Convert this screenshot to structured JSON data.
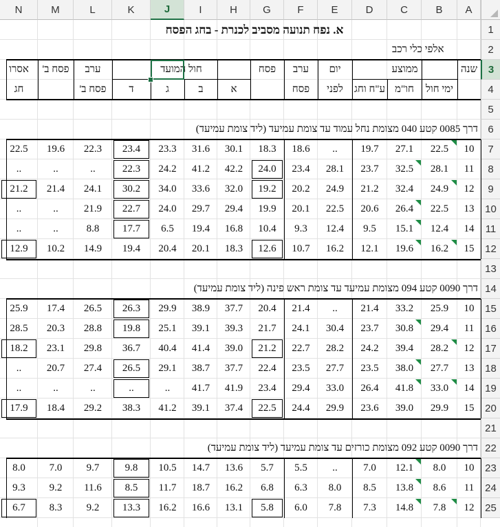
{
  "columns": [
    "N",
    "M",
    "L",
    "K",
    "J",
    "I",
    "H",
    "G",
    "F",
    "E",
    "D",
    "C",
    "B",
    "A"
  ],
  "selected_column": "J",
  "selected_row": "3",
  "rows": [
    "1",
    "2",
    "3",
    "4",
    "5",
    "6",
    "7",
    "8",
    "9",
    "10",
    "11",
    "12",
    "13",
    "14",
    "15",
    "16",
    "17",
    "18",
    "19",
    "20",
    "21",
    "22",
    "23",
    "24",
    "25"
  ],
  "title": "א.  נפח תנועה מסביב לכנרת - בחג הפסח",
  "units": "אלפי כלי רכב",
  "header": {
    "year": "שנה",
    "avg": "ממוצע",
    "weekdays": "ימי חול",
    "hol_hamoed_hdr": "חו\"מ",
    "holiday_rh": "ע\"ח וחג",
    "day_before_1": "יום",
    "day_before_2": "לפני",
    "erev_1": "ערב",
    "erev_2": "פסח",
    "pesach": "פסח",
    "hol_hamoed": "חול המועד",
    "a": "א",
    "b": "ב",
    "g": "ג",
    "d": "ד",
    "erev_b_1": "ערב",
    "erev_b_2": "פסח ב'",
    "pesach_b": "פסח ב'",
    "isru_1": "אסרו",
    "isru_2": "חג"
  },
  "sections": [
    {
      "label": "דרך 0085 קטע 040  מצומת נחל עמוד עד צומת עמיעד  (ליד צומת עמיעד)",
      "rows": [
        {
          "A": "10",
          "B": "22.5",
          "C": "27.1",
          "D": "19.7",
          "E": "..",
          "F": "18.6",
          "G": "18.3",
          "H": "30.1",
          "I": "31.6",
          "J": "23.3",
          "K": "23.4",
          "L": "22.3",
          "M": "19.6",
          "N": "22.5"
        },
        {
          "A": "11",
          "B": "28.1",
          "C": "32.5",
          "D": "23.7",
          "E": "28.1",
          "F": "23.4",
          "G": "24.0",
          "H": "42.2",
          "I": "41.2",
          "J": "24.2",
          "K": "22.3",
          "L": "..",
          "M": "..",
          "N": ".."
        },
        {
          "A": "12",
          "B": "24.9",
          "C": "32.4",
          "D": "21.2",
          "E": "24.9",
          "F": "20.2",
          "G": "19.2",
          "H": "32.0",
          "I": "33.6",
          "J": "34.0",
          "K": "30.2",
          "L": "24.1",
          "M": "21.4",
          "N": "21.2"
        },
        {
          "A": "13",
          "B": "22.5",
          "C": "26.4",
          "D": "20.6",
          "E": "22.5",
          "F": "20.1",
          "G": "19.9",
          "H": "29.4",
          "I": "29.7",
          "J": "24.0",
          "K": "22.7",
          "L": "21.9",
          "M": "..",
          "N": ".."
        },
        {
          "A": "14",
          "B": "12.4",
          "C": "15.1",
          "D": "9.5",
          "E": "12.4",
          "F": "9.3",
          "G": "10.4",
          "H": "16.8",
          "I": "19.4",
          "J": "6.5",
          "K": "17.7",
          "L": "8.8",
          "M": "..",
          "N": ".."
        },
        {
          "A": "15",
          "B": "16.2",
          "C": "19.6",
          "D": "12.1",
          "E": "16.2",
          "F": "10.7",
          "G": "12.6",
          "H": "18.3",
          "I": "20.1",
          "J": "20.4",
          "K": "19.4",
          "L": "14.9",
          "M": "10.2",
          "N": "12.9"
        }
      ]
    },
    {
      "label": "דרך 0090 קטע 094 מצומת עמיעד עד צומת ראש פינה  (ליד צומת עמיעד)",
      "rows": [
        {
          "A": "10",
          "B": "25.9",
          "C": "33.2",
          "D": "21.4",
          "E": "..",
          "F": "21.4",
          "G": "20.4",
          "H": "37.7",
          "I": "38.9",
          "J": "29.9",
          "K": "26.3",
          "L": "26.5",
          "M": "17.4",
          "N": "25.9"
        },
        {
          "A": "11",
          "B": "29.4",
          "C": "30.8",
          "D": "23.7",
          "E": "30.4",
          "F": "24.1",
          "G": "21.7",
          "H": "39.3",
          "I": "39.1",
          "J": "25.1",
          "K": "19.8",
          "L": "28.8",
          "M": "20.3",
          "N": "28.5"
        },
        {
          "A": "12",
          "B": "28.2",
          "C": "39.4",
          "D": "24.2",
          "E": "28.2",
          "F": "22.7",
          "G": "21.2",
          "H": "39.0",
          "I": "41.4",
          "J": "40.4",
          "K": "36.7",
          "L": "29.8",
          "M": "23.1",
          "N": "18.2"
        },
        {
          "A": "13",
          "B": "27.7",
          "C": "38.0",
          "D": "23.5",
          "E": "27.7",
          "F": "23.5",
          "G": "22.4",
          "H": "37.7",
          "I": "38.7",
          "J": "29.1",
          "K": "26.5",
          "L": "27.4",
          "M": "20.7",
          "N": ".."
        },
        {
          "A": "14",
          "B": "33.0",
          "C": "41.8",
          "D": "26.4",
          "E": "33.0",
          "F": "29.4",
          "G": "23.4",
          "H": "41.9",
          "I": "41.7",
          "J": "..",
          "K": "..",
          "L": "..",
          "M": "..",
          "N": ".."
        },
        {
          "A": "15",
          "B": "29.9",
          "C": "39.0",
          "D": "23.6",
          "E": "29.9",
          "F": "24.4",
          "G": "22.5",
          "H": "37.4",
          "I": "39.1",
          "J": "41.2",
          "K": "38.3",
          "L": "29.2",
          "M": "18.4",
          "N": "17.9"
        }
      ]
    },
    {
      "label": "דרך 0090 קטע 092 מצומת כורזים עד צומת עמיעד  (ליד צומת עמיעד)",
      "rows": [
        {
          "A": "10",
          "B": "8.0",
          "C": "12.1",
          "D": "7.0",
          "E": "..",
          "F": "5.5",
          "G": "5.7",
          "H": "13.6",
          "I": "14.7",
          "J": "10.5",
          "K": "9.8",
          "L": "9.7",
          "M": "7.0",
          "N": "8.0"
        },
        {
          "A": "11",
          "B": "8.6",
          "C": "13.8",
          "D": "8.5",
          "E": "8.0",
          "F": "6.3",
          "G": "6.8",
          "H": "16.2",
          "I": "18.7",
          "J": "11.7",
          "K": "8.5",
          "L": "11.6",
          "M": "9.2",
          "N": "9.3"
        },
        {
          "A": "12",
          "B": "7.8",
          "C": "14.8",
          "D": "7.3",
          "E": "7.8",
          "F": "6.0",
          "G": "5.8",
          "H": "13.1",
          "I": "16.6",
          "J": "16.2",
          "K": "13.3",
          "L": "9.2",
          "M": "8.3",
          "N": "6.7"
        }
      ]
    }
  ]
}
